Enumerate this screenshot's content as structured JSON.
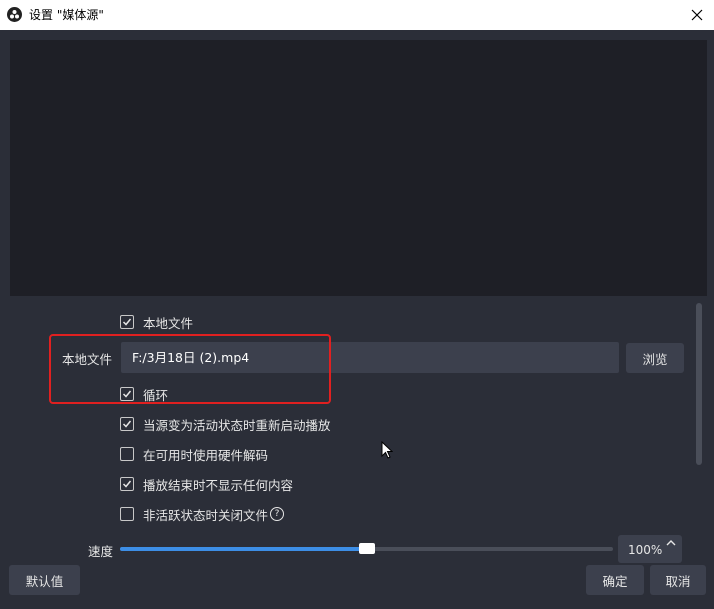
{
  "window": {
    "title": "设置 \"媒体源\""
  },
  "options": {
    "local_file_check": {
      "label": "本地文件",
      "checked": true
    },
    "local_file_field": {
      "label": "本地文件",
      "value": "F:/3月18日 (2).mp4"
    },
    "browse_label": "浏览",
    "loop": {
      "label": "循环",
      "checked": true
    },
    "restart_on_activate": {
      "label": "当源变为活动状态时重新启动播放",
      "checked": true
    },
    "hw_decode": {
      "label": "在可用时使用硬件解码",
      "checked": false
    },
    "hide_when_done": {
      "label": "播放结束时不显示任何内容",
      "checked": true
    },
    "close_file_inactive": {
      "label": "非活跃状态时关闭文件",
      "checked": false
    }
  },
  "speed": {
    "label": "速度",
    "value_text": "100%",
    "slider_fraction": 0.5
  },
  "footer": {
    "defaults_label": "默认值",
    "ok_label": "确定",
    "cancel_label": "取消"
  },
  "colors": {
    "accent": "#3d8ee6",
    "highlight_box": "#e02020",
    "background": "#2b2e38"
  },
  "icons": {
    "app": "obs-logo-icon",
    "close": "close-icon",
    "check": "checkmark-icon",
    "help": "question-circle-icon",
    "spin_up": "chevron-up-icon",
    "cursor": "mouse-pointer-icon"
  }
}
